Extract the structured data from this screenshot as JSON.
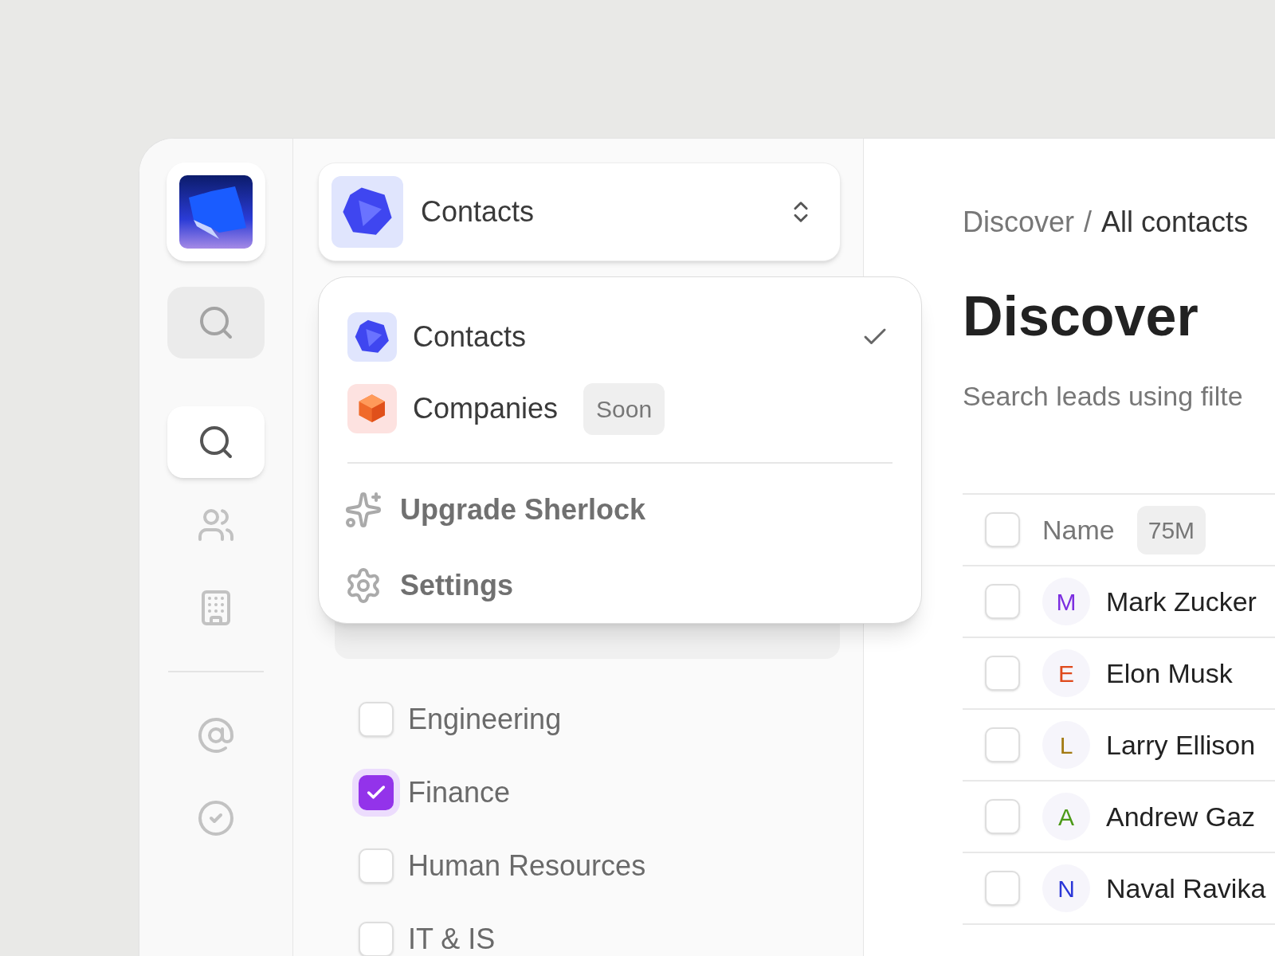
{
  "sidebar": {
    "items": [
      {
        "kind": "search",
        "selected": false,
        "hovered": true
      },
      {
        "kind": "search",
        "selected": true,
        "hovered": false
      },
      {
        "kind": "people",
        "selected": false,
        "hovered": false
      },
      {
        "kind": "building",
        "selected": false,
        "hovered": false
      },
      {
        "kind": "divider"
      },
      {
        "kind": "at",
        "selected": false,
        "hovered": false
      },
      {
        "kind": "check",
        "selected": false,
        "hovered": false
      }
    ]
  },
  "workspace_picker": {
    "label": "Contacts",
    "kind": "contacts"
  },
  "menu": {
    "options": [
      {
        "label": "Contacts",
        "kind": "contacts",
        "selected": true
      },
      {
        "label": "Companies",
        "kind": "companies",
        "selected": false,
        "badge": "Soon"
      }
    ],
    "actions": [
      {
        "label": "Upgrade Sherlock",
        "kind": "sparkles"
      },
      {
        "label": "Settings",
        "kind": "settings"
      }
    ]
  },
  "filter": {
    "options": [
      {
        "label": "Engineering",
        "checked": false
      },
      {
        "label": "Finance",
        "checked": true
      },
      {
        "label": "Human Resources",
        "checked": false
      },
      {
        "label": "IT & IS",
        "checked": false
      }
    ]
  },
  "breadcrumb": {
    "parent": "Discover",
    "separator": "/",
    "current": "All contacts"
  },
  "title": "Discover",
  "subtitle": "Search leads using filte",
  "table": {
    "header": {
      "label": "Name",
      "count": "75M",
      "checked": false
    },
    "rows": [
      {
        "initial": "M",
        "name": "Mark Zucker",
        "color": "#7c2ee0",
        "checked": false
      },
      {
        "initial": "E",
        "name": "Elon Musk",
        "color": "#df4a1c",
        "checked": false
      },
      {
        "initial": "L",
        "name": "Larry Ellison",
        "color": "#a37a12",
        "checked": false
      },
      {
        "initial": "A",
        "name": "Andrew Gaz",
        "color": "#4c9a18",
        "checked": false
      },
      {
        "initial": "N",
        "name": "Naval Ravika",
        "color": "#2a36d8",
        "checked": false
      }
    ]
  }
}
